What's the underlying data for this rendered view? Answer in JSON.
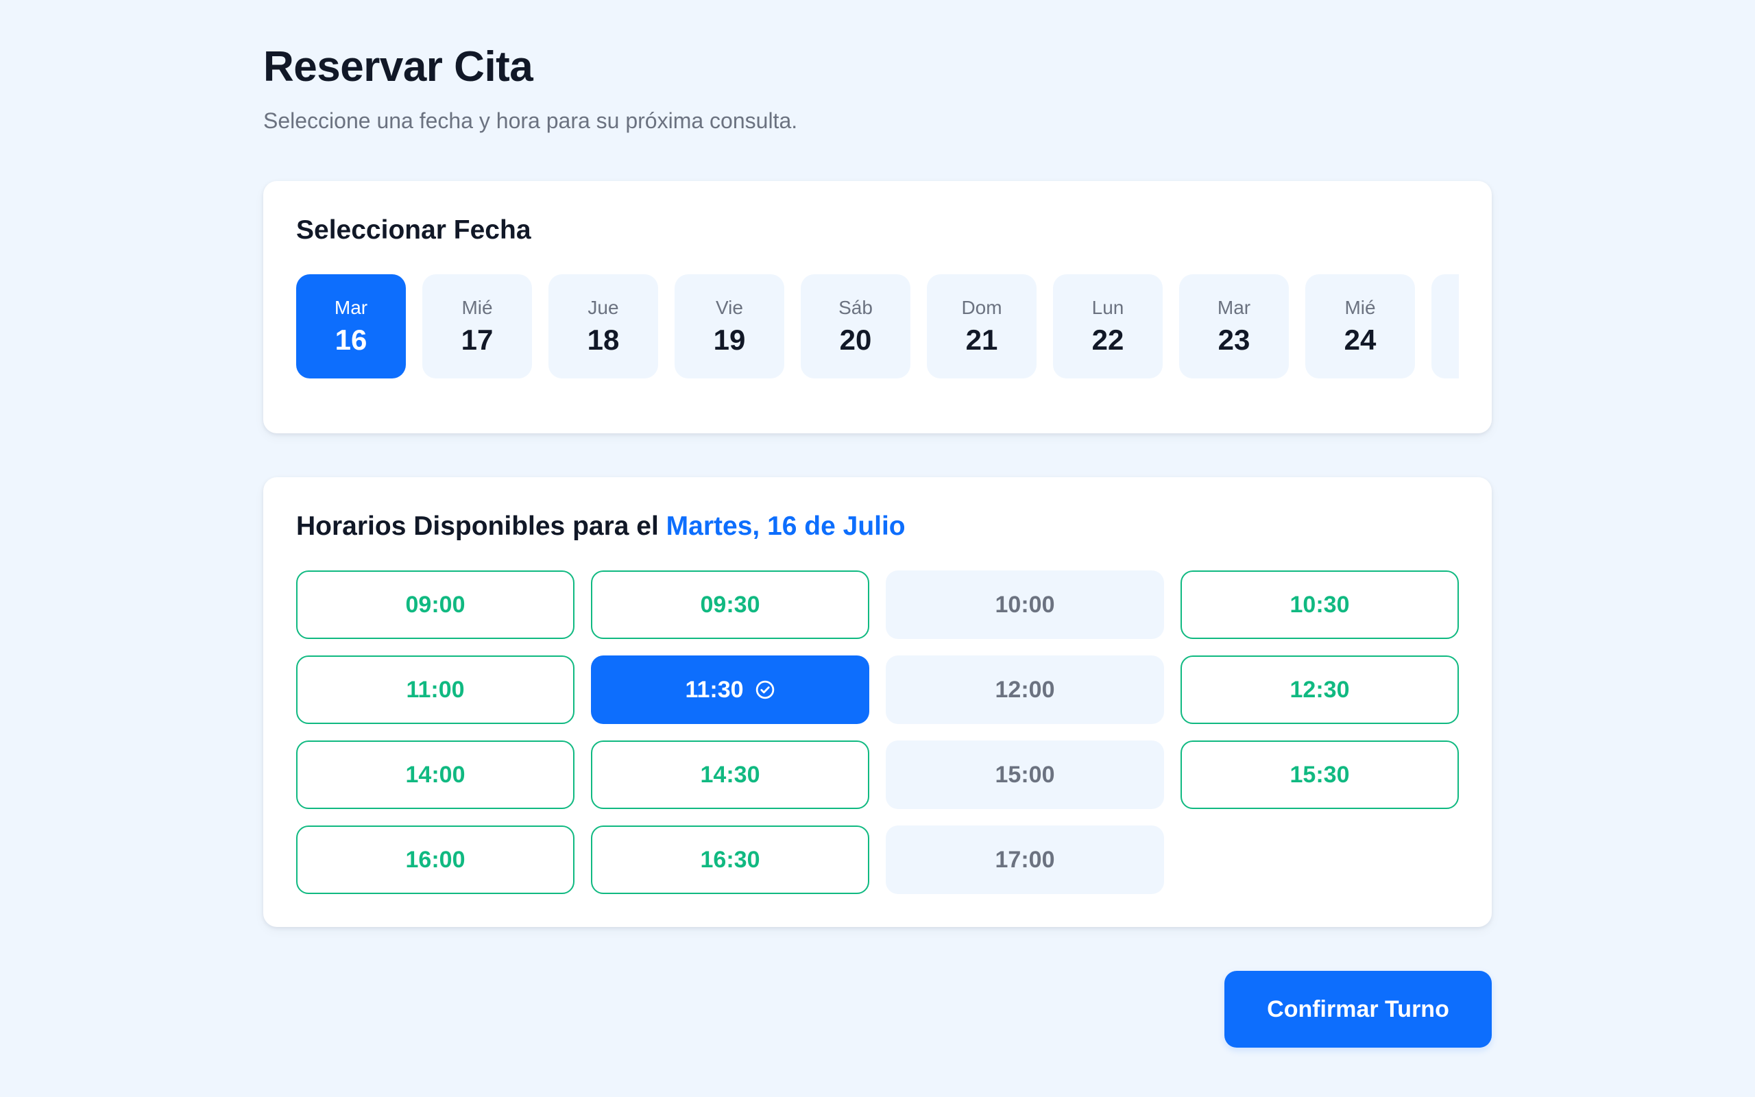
{
  "header": {
    "title": "Reservar Cita",
    "subtitle": "Seleccione una fecha y hora para su próxima consulta."
  },
  "date_picker": {
    "title": "Seleccionar Fecha",
    "selected_index": 0,
    "dates": [
      {
        "day": "Mar",
        "num": "16"
      },
      {
        "day": "Mié",
        "num": "17"
      },
      {
        "day": "Jue",
        "num": "18"
      },
      {
        "day": "Vie",
        "num": "19"
      },
      {
        "day": "Sáb",
        "num": "20"
      },
      {
        "day": "Dom",
        "num": "21"
      },
      {
        "day": "Lun",
        "num": "22"
      },
      {
        "day": "Mar",
        "num": "23"
      },
      {
        "day": "Mié",
        "num": "24"
      },
      {
        "day": "",
        "num": ""
      }
    ]
  },
  "time_slots": {
    "title_prefix": "Horarios Disponibles para el ",
    "selected_date_label": "Martes, 16 de Julio",
    "slots": [
      {
        "time": "09:00",
        "status": "available"
      },
      {
        "time": "09:30",
        "status": "available"
      },
      {
        "time": "10:00",
        "status": "unavailable"
      },
      {
        "time": "10:30",
        "status": "available"
      },
      {
        "time": "11:00",
        "status": "available"
      },
      {
        "time": "11:30",
        "status": "selected"
      },
      {
        "time": "12:00",
        "status": "unavailable"
      },
      {
        "time": "12:30",
        "status": "available"
      },
      {
        "time": "14:00",
        "status": "available"
      },
      {
        "time": "14:30",
        "status": "available"
      },
      {
        "time": "15:00",
        "status": "unavailable"
      },
      {
        "time": "15:30",
        "status": "available"
      },
      {
        "time": "16:00",
        "status": "available"
      },
      {
        "time": "16:30",
        "status": "available"
      },
      {
        "time": "17:00",
        "status": "unavailable"
      }
    ],
    "selected_icon": "check-circle-icon"
  },
  "actions": {
    "confirm_label": "Confirmar Turno"
  },
  "colors": {
    "background": "#eff6fe",
    "primary": "#0d6efd",
    "available": "#10b981",
    "muted_text": "#6b7280",
    "heading_text": "#111827"
  }
}
